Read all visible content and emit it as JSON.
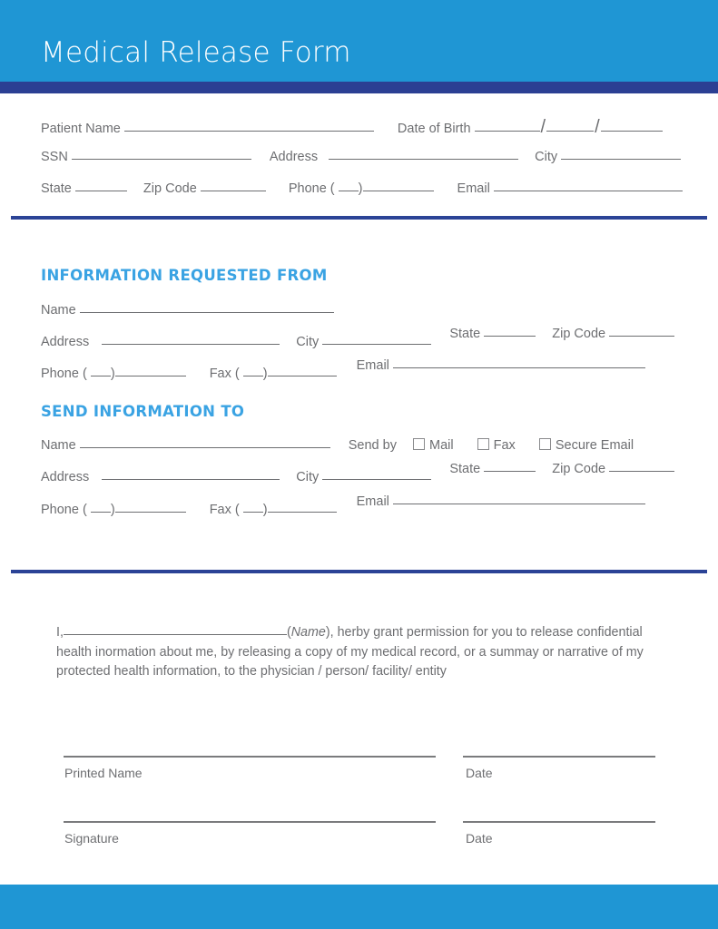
{
  "document": {
    "title": "Medical Release Form"
  },
  "colors": {
    "header_blue": "#1f96d4",
    "header_underbar_navy": "#2b3f93",
    "divider_navy": "#2b4396",
    "section_title_blue": "#3aa3e3",
    "text_gray": "#6d6e71",
    "footer_blue": "#1f96d4"
  },
  "patient_section": {
    "row1": {
      "patient_name_label": "Patient Name",
      "date_of_birth_label": "Date of Birth",
      "date_separator": "/"
    },
    "row2": {
      "ssn_label": "SSN",
      "address_label": "Address",
      "city_label": "City"
    },
    "row3": {
      "state_label": "State",
      "zip_code_label": "Zip Code",
      "phone_label_open": "Phone (",
      "phone_label_close": ")",
      "email_label": "Email"
    }
  },
  "requested_from_section": {
    "title": "INFORMATION REQUESTED FROM",
    "row1": {
      "name_label": "Name"
    },
    "row2": {
      "address_label": "Address",
      "city_label": "City",
      "state_label": "State",
      "zip_code_label": "Zip Code"
    },
    "row3": {
      "phone_label_open": "Phone (",
      "phone_label_close": ")",
      "fax_label_open": "Fax (",
      "fax_label_close": ")",
      "email_label": "Email"
    }
  },
  "send_to_section": {
    "title": "SEND INFORMATION TO",
    "row1": {
      "name_label": "Name",
      "send_by_label": "Send by",
      "options": [
        "Mail",
        "Fax",
        "Secure Email"
      ]
    },
    "row2": {
      "address_label": "Address",
      "city_label": "City",
      "state_label": "State",
      "zip_code_label": "Zip Code"
    },
    "row3": {
      "phone_label_open": "Phone (",
      "phone_label_close": ")",
      "fax_label_open": "Fax (",
      "fax_label_close": ")",
      "email_label": "Email"
    }
  },
  "consent": {
    "lead": "I,",
    "name_hint": "(Name)",
    "name_hint_italic": "Name",
    "text_after_name": ", herby grant permission for you to release confidential health inormation about me, by releasing a copy of my medical record, or a summay or narrative of my protected health information, to the physician / person/ facility/ entity"
  },
  "signature_section": {
    "printed_name_label": "Printed Name",
    "printed_name_date_label": "Date",
    "signature_label": "Signature",
    "signature_date_label": "Date"
  }
}
